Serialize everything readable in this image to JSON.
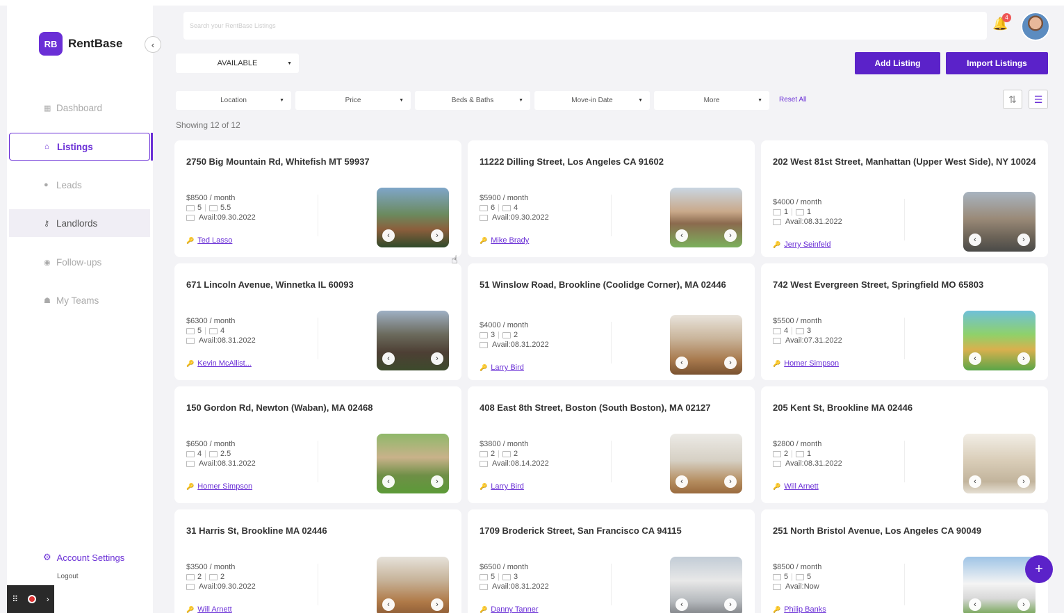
{
  "app": {
    "logo_abbr": "RB",
    "name": "RentBase",
    "brand_color": "#5b22c9"
  },
  "sidebar": {
    "items": [
      {
        "label": "Dashboard",
        "icon": "grid-icon"
      },
      {
        "label": "Listings",
        "icon": "home-icon",
        "active": true
      },
      {
        "label": "Leads",
        "icon": "user-icon"
      },
      {
        "label": "Landlords",
        "icon": "key-icon"
      },
      {
        "label": "Follow-ups",
        "icon": "circle-icon"
      },
      {
        "label": "My Teams",
        "icon": "team-icon"
      }
    ],
    "account_settings": "Account Settings",
    "logout": "Logout"
  },
  "header": {
    "search_placeholder": "Search your RentBase Listings",
    "notification_count": "4"
  },
  "toolbar": {
    "status_filter": "AVAILABLE",
    "add_listing": "Add Listing",
    "import_listings": "Import Listings",
    "filters": [
      "Location",
      "Price",
      "Beds & Baths",
      "Move-in Date",
      "More"
    ],
    "reset_all": "Reset All",
    "showing": "Showing 12 of 12"
  },
  "listings": [
    {
      "address": "2750 Big Mountain Rd, Whitefish MT 59937",
      "price": "$8500 / month",
      "beds": "5",
      "baths": "5.5",
      "avail": "Avail:09.30.2022",
      "landlord": "Ted Lasso"
    },
    {
      "address": "11222 Dilling Street, Los Angeles CA 91602",
      "price": "$5900 / month",
      "beds": "6",
      "baths": "4",
      "avail": "Avail:09.30.2022",
      "landlord": "Mike Brady"
    },
    {
      "address": "202 West 81st Street, Manhattan (Upper West Side), NY 10024",
      "price": "$4000 / month",
      "beds": "1",
      "baths": "1",
      "avail": "Avail:08.31.2022",
      "landlord": "Jerry Seinfeld"
    },
    {
      "address": "671 Lincoln Avenue, Winnetka IL 60093",
      "price": "$6300 / month",
      "beds": "5",
      "baths": "4",
      "avail": "Avail:08.31.2022",
      "landlord": "Kevin McAllist..."
    },
    {
      "address": "51 Winslow Road, Brookline (Coolidge Corner), MA 02446",
      "price": "$4000 / month",
      "beds": "3",
      "baths": "2",
      "avail": "Avail:08.31.2022",
      "landlord": "Larry Bird"
    },
    {
      "address": "742 West Evergreen Street, Springfield MO 65803",
      "price": "$5500 / month",
      "beds": "4",
      "baths": "3",
      "avail": "Avail:07.31.2022",
      "landlord": "Homer Simpson"
    },
    {
      "address": "150 Gordon Rd, Newton (Waban), MA 02468",
      "price": "$6500 / month",
      "beds": "4",
      "baths": "2.5",
      "avail": "Avail:08.31.2022",
      "landlord": "Homer Simpson"
    },
    {
      "address": "408 East 8th Street, Boston (South Boston), MA 02127",
      "price": "$3800 / month",
      "beds": "2",
      "baths": "2",
      "avail": "Avail:08.14.2022",
      "landlord": "Larry Bird"
    },
    {
      "address": "205 Kent St, Brookline MA 02446",
      "price": "$2800 / month",
      "beds": "2",
      "baths": "1",
      "avail": "Avail:08.31.2022",
      "landlord": "Will Arnett"
    },
    {
      "address": "31 Harris St, Brookline MA 02446",
      "price": "$3500 / month",
      "beds": "2",
      "baths": "2",
      "avail": "Avail:09.30.2022",
      "landlord": "Will Arnett"
    },
    {
      "address": "1709 Broderick Street, San Francisco CA 94115",
      "price": "$6500 / month",
      "beds": "5",
      "baths": "3",
      "avail": "Avail:08.31.2022",
      "landlord": "Danny Tanner"
    },
    {
      "address": "251 North Bristol Avenue, Los Angeles CA 90049",
      "price": "$8500 / month",
      "beds": "5",
      "baths": "5",
      "avail": "Avail:Now",
      "landlord": "Philip Banks"
    }
  ]
}
